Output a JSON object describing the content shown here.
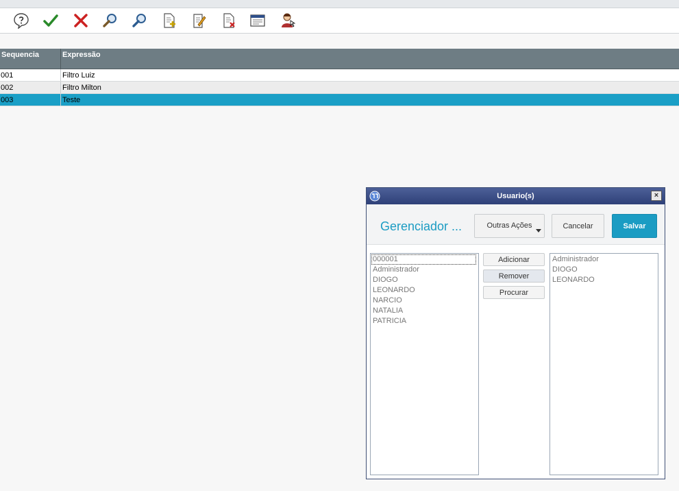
{
  "toolbar": {
    "buttons": [
      {
        "name": "help",
        "icon": "help-icon"
      },
      {
        "name": "confirm",
        "icon": "check-icon"
      },
      {
        "name": "cancel",
        "icon": "x-icon"
      },
      {
        "name": "search",
        "icon": "search-icon"
      },
      {
        "name": "search-2",
        "icon": "search-icon"
      },
      {
        "name": "new-document",
        "icon": "new-document-icon"
      },
      {
        "name": "edit-document",
        "icon": "edit-document-icon"
      },
      {
        "name": "delete-document",
        "icon": "delete-document-icon"
      },
      {
        "name": "window",
        "icon": "window-icon"
      },
      {
        "name": "users",
        "icon": "user-icon"
      }
    ]
  },
  "grid": {
    "columns": {
      "seq": "Sequencia",
      "exp": "Expressão"
    },
    "rows": [
      {
        "seq": "001",
        "exp": "Filtro Luiz"
      },
      {
        "seq": "002",
        "exp": "Filtro Milton"
      },
      {
        "seq": "003",
        "exp": "Teste"
      }
    ]
  },
  "dialog": {
    "title": "Usuario(s)",
    "close_glyph": "×",
    "heading": "Gerenciador ...",
    "outras_label": "Outras Ações",
    "cancel_label": "Cancelar",
    "save_label": "Salvar",
    "add_label": "Adicionar",
    "remove_label": "Remover",
    "find_label": "Procurar",
    "available": [
      "000001",
      "Administrador",
      "DIOGO",
      "LEONARDO",
      "NARCIO",
      "NATALIA",
      "PATRICIA"
    ],
    "selected": [
      "Administrador",
      "DIOGO",
      "LEONARDO"
    ]
  },
  "colors": {
    "header_bg": "#6e7d84",
    "selected_row": "#1a9fc6",
    "accent": "#1b9cc3",
    "dialog_title": "#2e4078"
  }
}
